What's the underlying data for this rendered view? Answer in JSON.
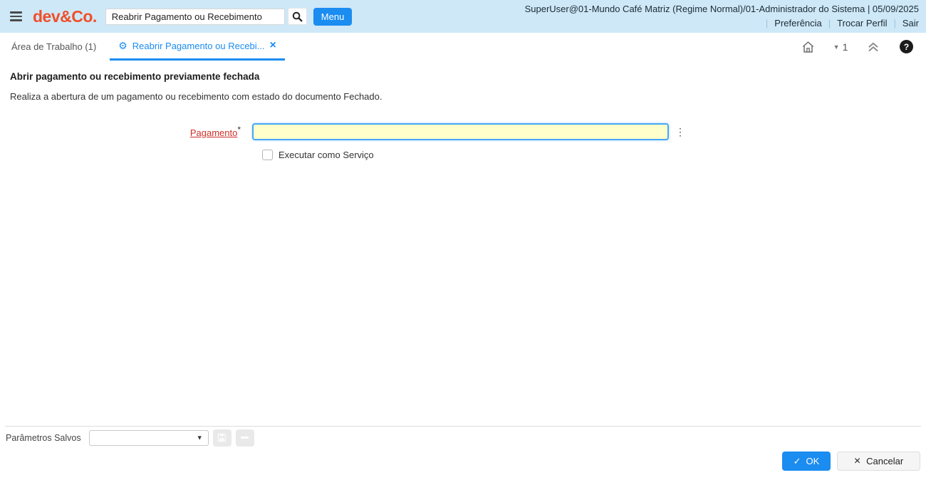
{
  "header": {
    "logo_text": "dev&Co.",
    "search": {
      "value": "Reabrir Pagamento ou Recebimento"
    },
    "menu_label": "Menu",
    "user_info": "SuperUser@01-Mundo Café Matriz (Regime Normal)/01-Administrador do Sistema | 05/09/2025",
    "links": [
      "Preferência",
      "Trocar Perfil",
      "Sair"
    ]
  },
  "tabbar": {
    "workspace_label": "Área de Trabalho (1)",
    "active_tab_label": "Reabrir Pagamento ou Recebi...",
    "close_glyph": "×",
    "gear_glyph": "⚙",
    "window_count": "1",
    "help_glyph": "?"
  },
  "process": {
    "title": "Abrir pagamento ou recebimento previamente fechada",
    "description": "Realiza a abertura de um pagamento ou recebimento com estado do documento Fechado.",
    "pagamento": {
      "label": "Pagamento",
      "required_marker": "*",
      "value": ""
    },
    "kebab_glyph": "⋮",
    "run_as_service_label": "Executar como Serviço"
  },
  "footer": {
    "saved_params_label": "Parâmetros Salvos",
    "saved_params_value": "",
    "ok": {
      "icon_glyph": "✓",
      "label": "OK"
    },
    "cancel": {
      "icon_glyph": "×",
      "label": "Cancelar"
    }
  },
  "colors": {
    "header_bg": "#cee8f8",
    "logo": "#f04f28",
    "accent_blue": "#1b8cf0",
    "mandatory_field_bg": "#ffffcc",
    "focus_border": "#45a7f5",
    "required_label": "#cd2f2a",
    "help_badge_bg": "#1b1b1b"
  }
}
